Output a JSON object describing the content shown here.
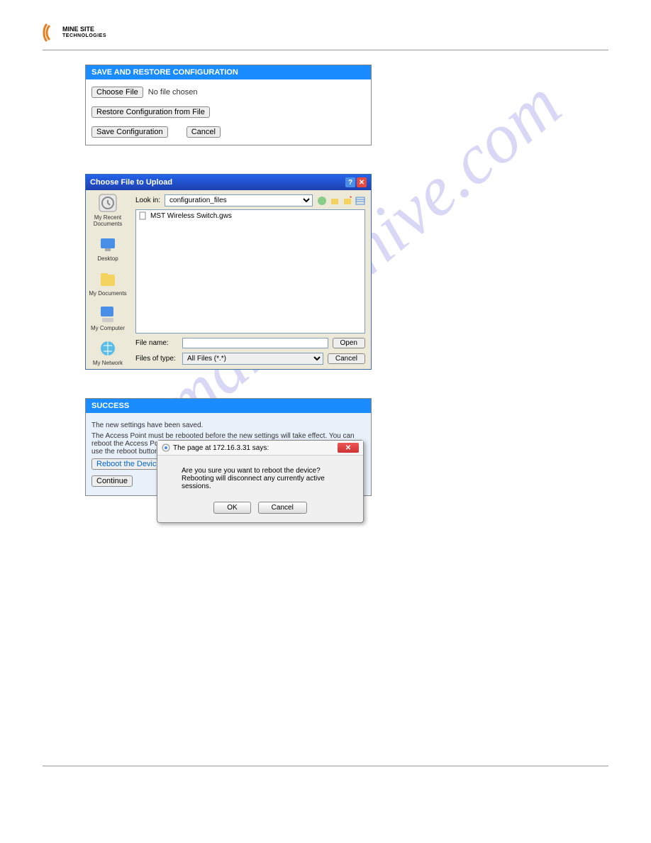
{
  "watermark": "manualshive.com",
  "logo": {
    "line1": "MINE SITE",
    "line2": "TECHNOLOGIES"
  },
  "panel1": {
    "title": "SAVE AND RESTORE CONFIGURATION",
    "choose_btn": "Choose File",
    "no_file": "No file chosen",
    "restore_btn": "Restore Configuration from File",
    "save_btn": "Save Configuration",
    "cancel_btn": "Cancel"
  },
  "panel2": {
    "title": "Choose File to Upload",
    "lookin_label": "Look in:",
    "lookin_value": "configuration_files",
    "file_item": "MST Wireless Switch.gws",
    "filename_label": "File name:",
    "filename_value": "",
    "filetype_label": "Files of type:",
    "filetype_value": "All Files (*.*)",
    "open_btn": "Open",
    "cancel_btn": "Cancel",
    "sidebar": {
      "recent": "My Recent Documents",
      "desktop": "Desktop",
      "mydocs": "My Documents",
      "mycomp": "My Computer",
      "mynet": "My Network"
    }
  },
  "panel3": {
    "title": "SUCCESS",
    "msg1": "The new settings have been saved.",
    "msg2": "The Access Point must be rebooted before the new settings will take effect. You can reboot the Access Point now using the button below, or make other changes and then use the reboot button on the Tools/System page.",
    "reboot_btn": "Reboot the Device",
    "continue_btn": "Continue"
  },
  "confirm": {
    "title": "The page at 172.16.3.31 says:",
    "line1": "Are you sure you want to reboot the device?",
    "line2": "Rebooting will disconnect any currently active sessions.",
    "ok": "OK",
    "cancel": "Cancel"
  }
}
